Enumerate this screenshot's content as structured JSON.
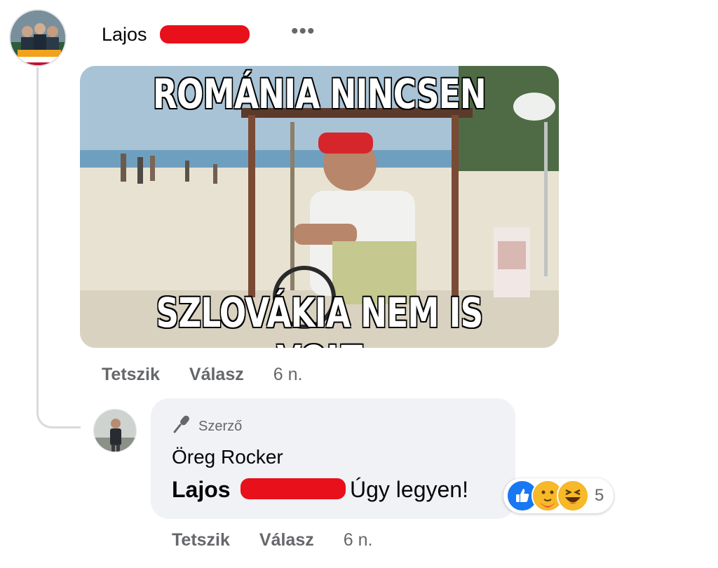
{
  "post_comment": {
    "author": "Lajos",
    "more_label": "•••",
    "meme": {
      "top_caption": "ROMÁNIA NINCSEN",
      "bottom_caption": "SZLOVÁKIA NEM IS VOLT"
    },
    "actions": {
      "like": "Tetszik",
      "reply": "Válasz",
      "time": "6 n."
    }
  },
  "reply": {
    "badge": "Szerző",
    "author": "Öreg Rocker",
    "mention": "Lajos",
    "text": "Úgy legyen!",
    "reactions": {
      "icons": [
        "like-icon",
        "care-icon",
        "haha-icon"
      ],
      "count": "5"
    },
    "actions": {
      "like": "Tetszik",
      "reply": "Válasz",
      "time": "6 n."
    }
  },
  "colors": {
    "secondary_text": "#65676b",
    "bubble_bg": "#f0f2f5",
    "redaction": "#e8101a",
    "like_blue": "#1877f2"
  }
}
